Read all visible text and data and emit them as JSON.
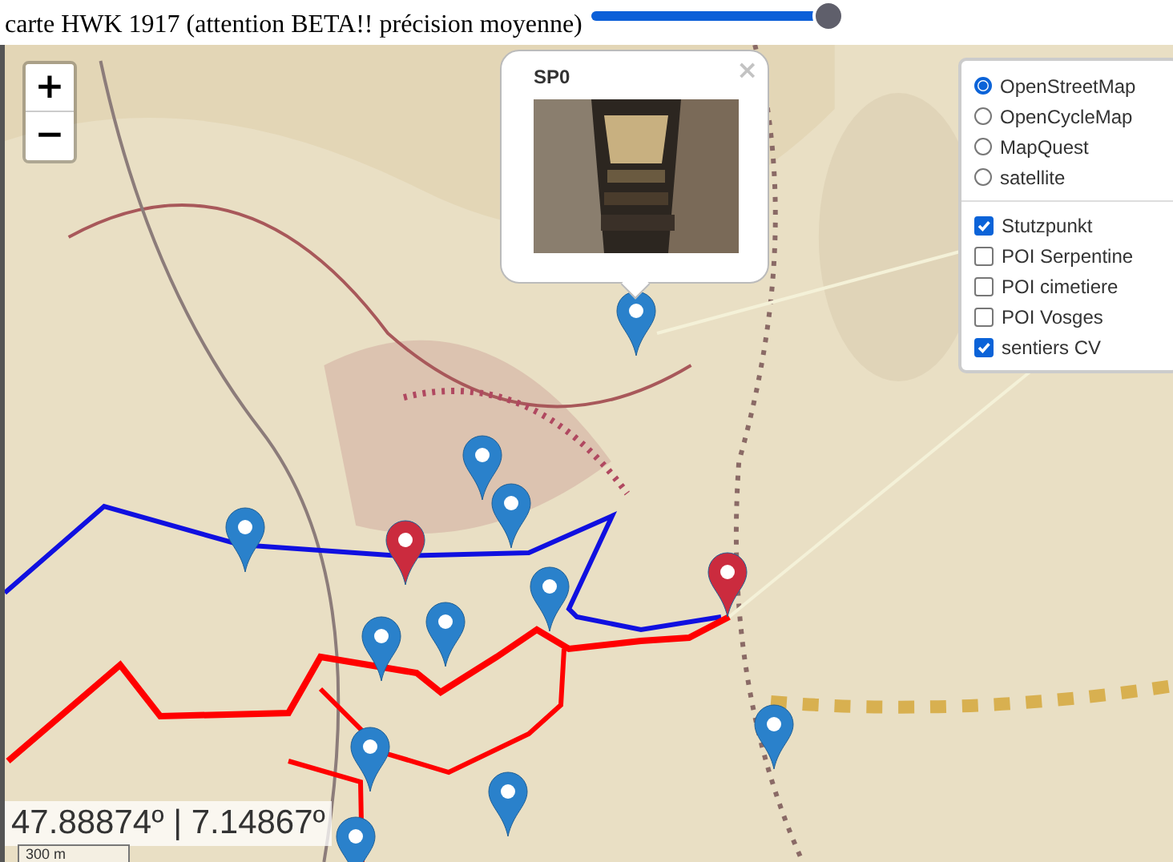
{
  "header": {
    "title": "carte HWK 1917 (attention BETA!! précision moyenne)",
    "opacity_slider": {
      "level": 1
    }
  },
  "map": {
    "zoom_in": "+",
    "zoom_out": "−",
    "popup": {
      "title": "SP0",
      "close": "×"
    },
    "markers": [
      {
        "color": "#2a81cb"
      },
      {
        "color": "#2a81cb"
      },
      {
        "color": "#2a81cb"
      },
      {
        "color": "#2a81cb"
      },
      {
        "color": "#2a81cb"
      },
      {
        "color": "#2a81cb"
      },
      {
        "color": "#2a81cb"
      },
      {
        "color": "#2a81cb"
      },
      {
        "color": "#2a81cb"
      },
      {
        "color": "#2a81cb"
      },
      {
        "color": "#2a81cb"
      },
      {
        "color": "#cb2b3e"
      },
      {
        "color": "#cb2b3e"
      }
    ],
    "layers": {
      "base": [
        {
          "label": "OpenStreetMap",
          "selected": true
        },
        {
          "label": "OpenCycleMap",
          "selected": false
        },
        {
          "label": "MapQuest",
          "selected": false
        },
        {
          "label": "satellite",
          "selected": false
        }
      ],
      "overlays": [
        {
          "label": "Stutzpunkt",
          "checked": true
        },
        {
          "label": "POI Serpentine",
          "checked": false
        },
        {
          "label": "POI cimetiere",
          "checked": false
        },
        {
          "label": "POI Vosges",
          "checked": false
        },
        {
          "label": "sentiers CV",
          "checked": true
        }
      ]
    },
    "coordinates": "47.88874º | 7.14867º",
    "scale": "300 m"
  }
}
